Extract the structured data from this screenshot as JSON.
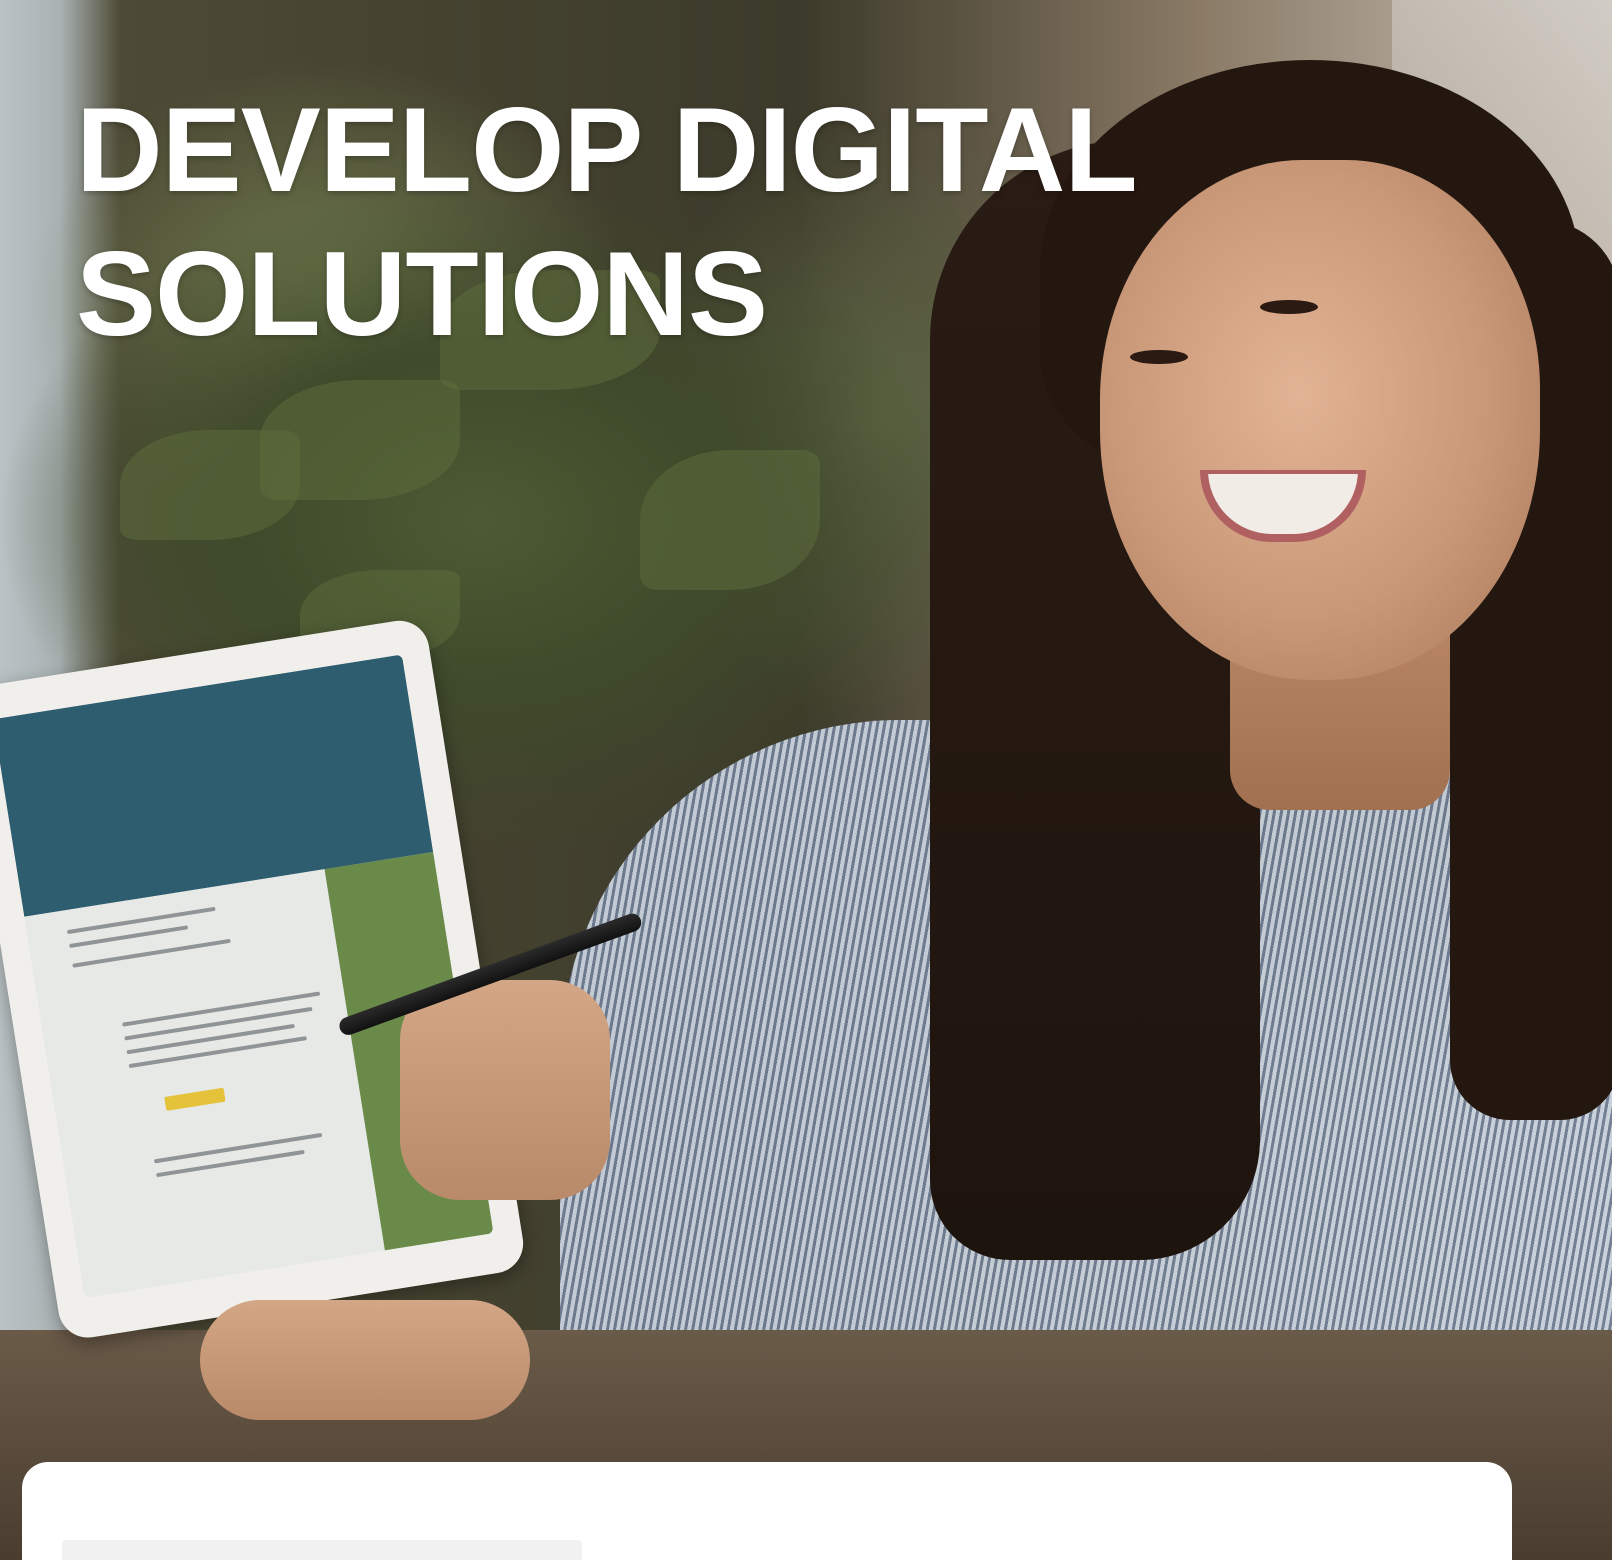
{
  "hero": {
    "headline_line1": "DEVELOP DIGITAL",
    "headline_line2": "SOLUTIONS",
    "photo_subject": "smiling woman holding a tablet and pen"
  }
}
